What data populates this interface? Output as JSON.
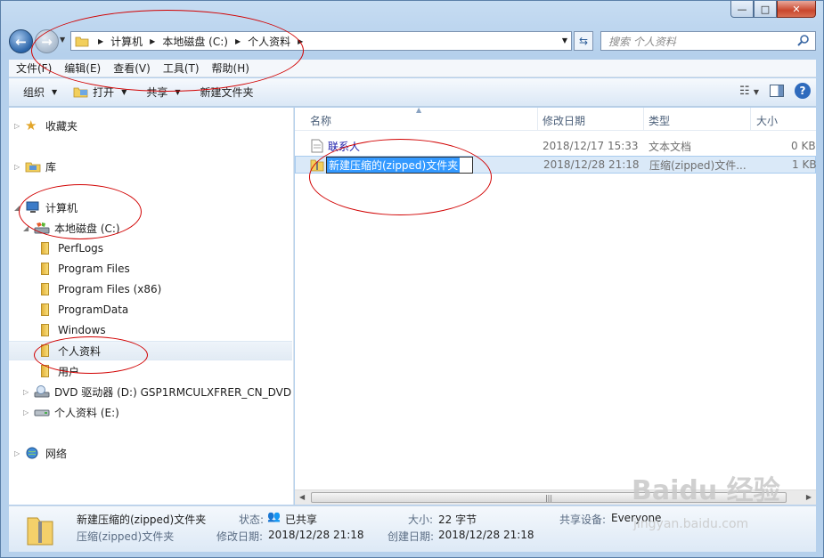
{
  "caption": {
    "minimize_glyph": "—",
    "maximize_glyph": "□",
    "close_glyph": "✕"
  },
  "navigation": {
    "breadcrumbs": [
      "计算机",
      "本地磁盘 (C:)",
      "个人资料"
    ],
    "search_placeholder": "搜索 个人资料"
  },
  "menu": {
    "items": [
      "文件(F)",
      "编辑(E)",
      "查看(V)",
      "工具(T)",
      "帮助(H)"
    ]
  },
  "toolbar": {
    "organize": "组织",
    "open": "打开",
    "share": "共享",
    "new_folder": "新建文件夹"
  },
  "tree": {
    "favorites": "收藏夹",
    "libraries": "库",
    "computer": "计算机",
    "drive_c": "本地磁盘 (C:)",
    "folders": [
      "PerfLogs",
      "Program Files",
      "Program Files (x86)",
      "ProgramData",
      "Windows",
      "个人资料",
      "用户"
    ],
    "drive_d": "DVD 驱动器 (D:) GSP1RMCULXFRER_CN_DVD",
    "drive_e": "个人资料 (E:)",
    "network": "网络"
  },
  "columns": {
    "name": "名称",
    "modified": "修改日期",
    "type": "类型",
    "size": "大小"
  },
  "files": [
    {
      "name": "联系人",
      "modified": "2018/12/17 15:33",
      "type": "文本文档",
      "size": "0 KB"
    },
    {
      "name": "新建压缩的(zipped)文件夹",
      "modified": "2018/12/28 21:18",
      "type": "压缩(zipped)文件...",
      "size": "1 KB"
    }
  ],
  "details": {
    "title": "新建压缩的(zipped)文件夹",
    "subtitle": "压缩(zipped)文件夹",
    "state_label": "状态:",
    "state_value": "已共享",
    "size_label": "大小:",
    "size_value": "22 字节",
    "share_label": "共享设备:",
    "share_value": "Everyone",
    "modified_label": "修改日期:",
    "modified_value": "2018/12/28 21:18",
    "created_label": "创建日期:",
    "created_value": "2018/12/28 21:18"
  },
  "watermark": {
    "brand": "Baidu 经验",
    "url": "jingyan.baidu.com"
  },
  "colors": {
    "annotation": "#d10000",
    "selection": "#3399ff",
    "link_blue": "#1a1aa8"
  }
}
